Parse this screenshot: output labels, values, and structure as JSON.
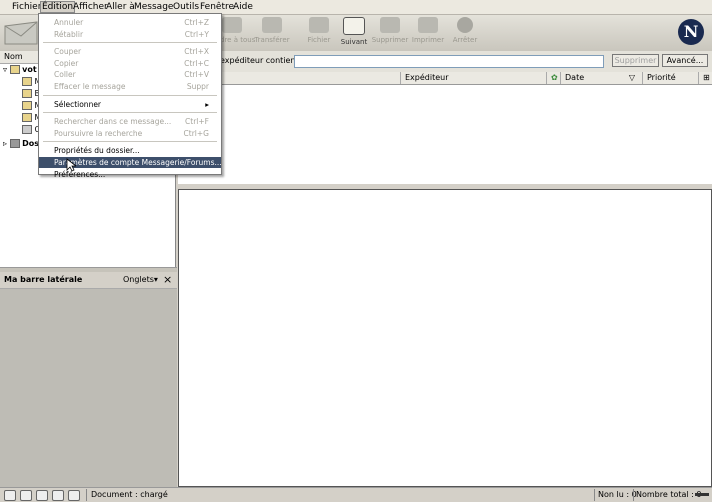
{
  "menubar": {
    "items": [
      "Fichier",
      "Édition",
      "Afficher",
      "Aller à",
      "Message",
      "Outils",
      "Fenêtre",
      "Aide"
    ]
  },
  "toolbar": {
    "buttons": [
      {
        "label": "Répondre à tous",
        "icon": "reply-all-icon",
        "enabled": false
      },
      {
        "label": "Transférer",
        "icon": "forward-icon",
        "enabled": false
      },
      {
        "label": "Fichier",
        "icon": "file-icon",
        "enabled": false
      },
      {
        "label": "Suivant",
        "icon": "next-icon",
        "enabled": true
      },
      {
        "label": "Supprimer",
        "icon": "delete-icon",
        "enabled": false
      },
      {
        "label": "Imprimer",
        "icon": "print-icon",
        "enabled": false
      },
      {
        "label": "Arrêter",
        "icon": "stop-icon",
        "enabled": false
      }
    ],
    "logo_letter": "N"
  },
  "folder_pane": {
    "header": "Nom",
    "tree": [
      {
        "label": "vot",
        "level": 0,
        "expanded": true
      },
      {
        "label": "M",
        "level": 1
      },
      {
        "label": "B",
        "level": 1
      },
      {
        "label": "M",
        "level": 1
      },
      {
        "label": "M",
        "level": 1
      },
      {
        "label": "C",
        "level": 1
      },
      {
        "label": "Dos",
        "level": 0,
        "expanded": false
      }
    ]
  },
  "search": {
    "label": "expéditeur contient :",
    "value": "",
    "clear_button": "Supprimer",
    "advanced_button": "Avancé..."
  },
  "columns": {
    "sender": "Expéditeur",
    "date": "Date",
    "priority": "Priorité"
  },
  "sidebar": {
    "title": "Ma barre latérale",
    "tabs_label": "Onglets",
    "close": "×"
  },
  "dropdown": {
    "items": [
      {
        "label": "Annuler",
        "shortcut": "Ctrl+Z",
        "disabled": true
      },
      {
        "label": "Rétablir",
        "shortcut": "Ctrl+Y",
        "disabled": true
      },
      {
        "sep": true
      },
      {
        "label": "Couper",
        "shortcut": "Ctrl+X",
        "disabled": true
      },
      {
        "label": "Copier",
        "shortcut": "Ctrl+C",
        "disabled": true
      },
      {
        "label": "Coller",
        "shortcut": "Ctrl+V",
        "disabled": true
      },
      {
        "label": "Effacer le message",
        "shortcut": "Suppr",
        "disabled": true
      },
      {
        "sep": true
      },
      {
        "label": "Sélectionner",
        "shortcut": "▸",
        "disabled": false
      },
      {
        "sep": true
      },
      {
        "label": "Rechercher dans ce message...",
        "shortcut": "Ctrl+F",
        "disabled": true
      },
      {
        "label": "Poursuivre la recherche",
        "shortcut": "Ctrl+G",
        "disabled": true
      },
      {
        "sep": true
      },
      {
        "label": "Propriétés du dossier...",
        "shortcut": "",
        "disabled": false
      },
      {
        "label": "Paramètres de compte Messagerie/Forums...",
        "shortcut": "",
        "disabled": false,
        "highlighted": true
      },
      {
        "label": "Préférences...",
        "shortcut": "",
        "disabled": false
      }
    ]
  },
  "statusbar": {
    "status": "Document : chargé",
    "unread": "Non lu : 0",
    "total": "Nombre total : 0"
  }
}
